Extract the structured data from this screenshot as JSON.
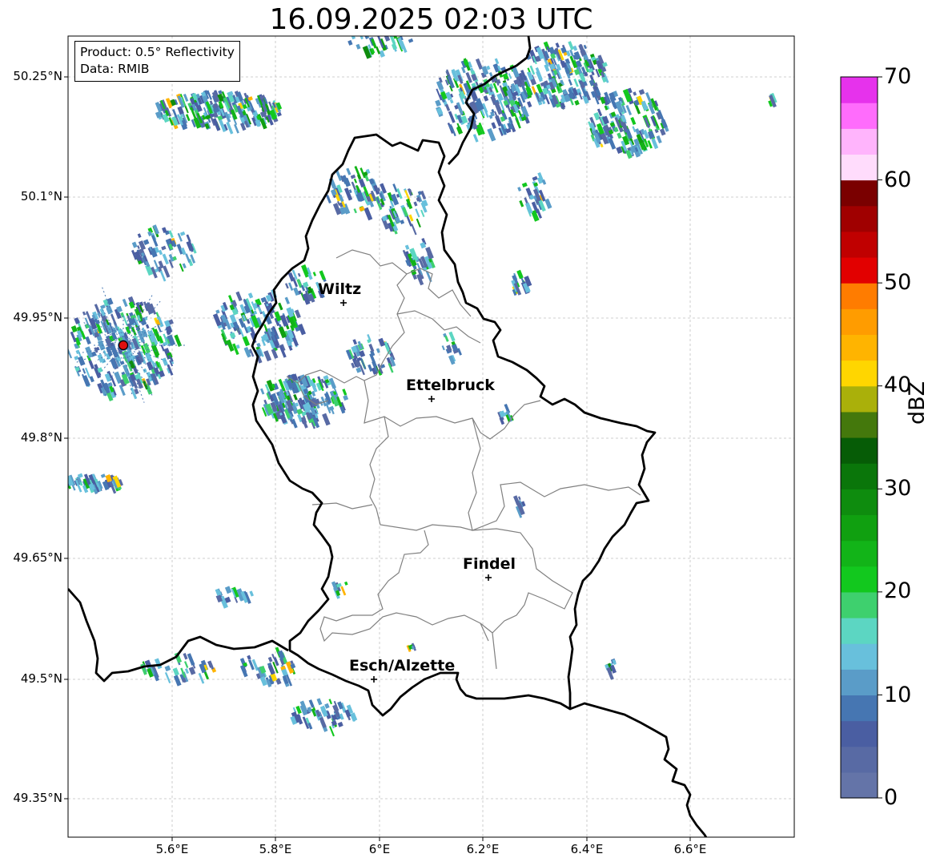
{
  "title": "16.09.2025 02:03 UTC",
  "info": {
    "product": "Product: 0.5° Reflectivity",
    "data": "Data: RMIB"
  },
  "axes": {
    "lat_ticks": [
      "50.25°N",
      "50.1°N",
      "49.95°N",
      "49.8°N",
      "49.65°N",
      "49.5°N",
      "49.35°N"
    ],
    "lon_ticks": [
      "5.6°E",
      "5.8°E",
      "6°E",
      "6.2°E",
      "6.4°E",
      "6.6°E"
    ],
    "grid": true
  },
  "colorbar": {
    "unit": "dBZ",
    "tick_labels": [
      "70",
      "60",
      "50",
      "40",
      "30",
      "20",
      "10",
      "0"
    ],
    "range": [
      0,
      70
    ],
    "step": 2.5,
    "colors": [
      "#6474a8",
      "#586aa4",
      "#4a5ea2",
      "#4676b2",
      "#5a9cc8",
      "#68c0dc",
      "#5cd6c2",
      "#3ed06e",
      "#12c81e",
      "#12b418",
      "#10a010",
      "#0e8c0e",
      "#0a760a",
      "#065c06",
      "#44780c",
      "#aab00a",
      "#ffd600",
      "#ffb400",
      "#ff9c00",
      "#ff7c00",
      "#e20000",
      "#c00000",
      "#a00000",
      "#7a0000",
      "#ffdcfc",
      "#ffb4fc",
      "#ff6cfc",
      "#e632ec"
    ]
  },
  "cities": [
    {
      "name": "Wiltz"
    },
    {
      "name": "Ettelbruck"
    },
    {
      "name": "Findel"
    },
    {
      "name": "Esch/Alzette"
    }
  ],
  "radar_site": {
    "color": "#e01010"
  },
  "colors": {
    "border": "#000000",
    "canton": "#808080",
    "grid": "#c0c0c0"
  }
}
